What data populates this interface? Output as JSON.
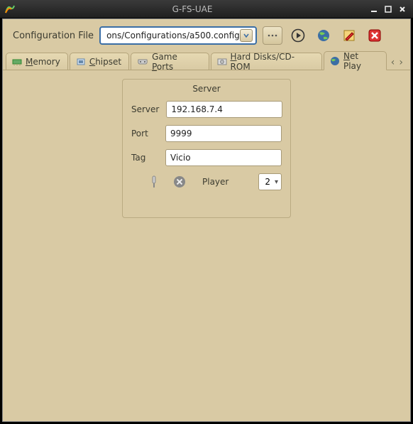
{
  "window": {
    "title": "G-FS-UAE"
  },
  "toolbar": {
    "config_label": "Configuration File",
    "config_value": "ons/Configurations/a500.config"
  },
  "tabs": [
    {
      "label_pre": "",
      "ul": "M",
      "label_post": "emory",
      "icon": "memory-icon",
      "active": false
    },
    {
      "label_pre": "",
      "ul": "C",
      "label_post": "hipset",
      "icon": "chipset-icon",
      "active": false
    },
    {
      "label_pre": "Game ",
      "ul": "P",
      "label_post": "orts",
      "icon": "gameports-icon",
      "active": false
    },
    {
      "label_pre": "",
      "ul": "H",
      "label_post": "ard Disks/CD-ROM",
      "icon": "harddisk-icon",
      "active": false
    },
    {
      "label_pre": "",
      "ul": "N",
      "label_post": "et Play",
      "icon": "netplay-icon",
      "active": true
    }
  ],
  "netplay": {
    "panel_title": "Server",
    "server_label": "Server",
    "server_value": "192.168.7.4",
    "port_label": "Port",
    "port_value": "9999",
    "tag_label": "Tag",
    "tag_value": "Vicio",
    "player_label": "Player",
    "player_value": "2"
  }
}
